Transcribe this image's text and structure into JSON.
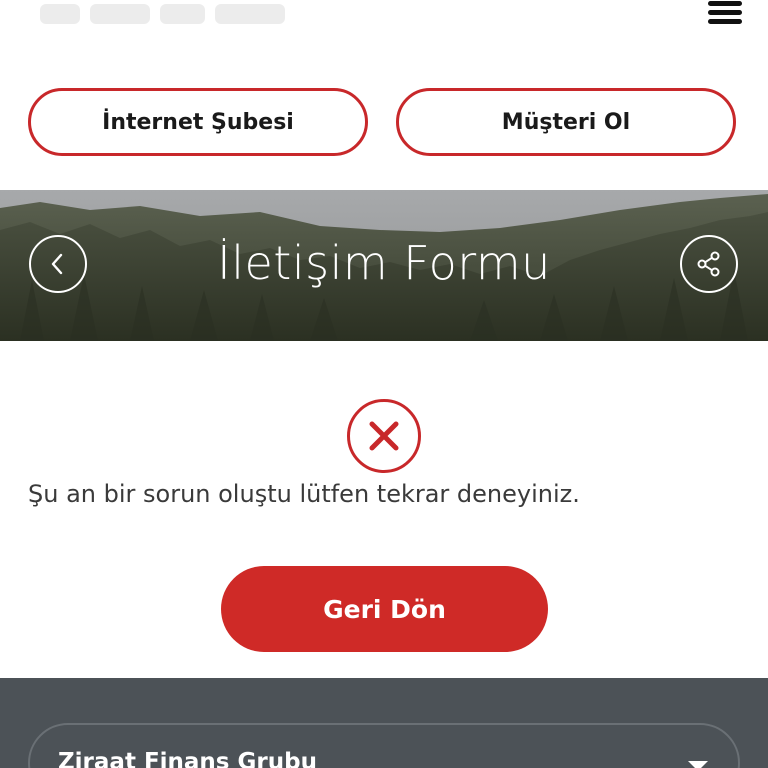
{
  "header": {
    "menu_icon": "hamburger-menu-icon"
  },
  "actions": {
    "internet_branch_label": "İnternet Şubesi",
    "become_customer_label": "Müşteri Ol"
  },
  "banner": {
    "title": "İletişim Formu",
    "back_icon": "chevron-left-icon",
    "share_icon": "share-icon"
  },
  "result": {
    "status_icon": "error-x-icon",
    "message": "Şu an bir sorun oluştu lütfen tekrar deneyiniz.",
    "back_button_label": "Geri Dön"
  },
  "footer": {
    "group_label": "Ziraat Finans Grubu",
    "caret_icon": "caret-down-icon"
  },
  "colors": {
    "brand_red": "#c8282a",
    "cta_red": "#cf2a27",
    "footer_bg": "#4c5257"
  }
}
